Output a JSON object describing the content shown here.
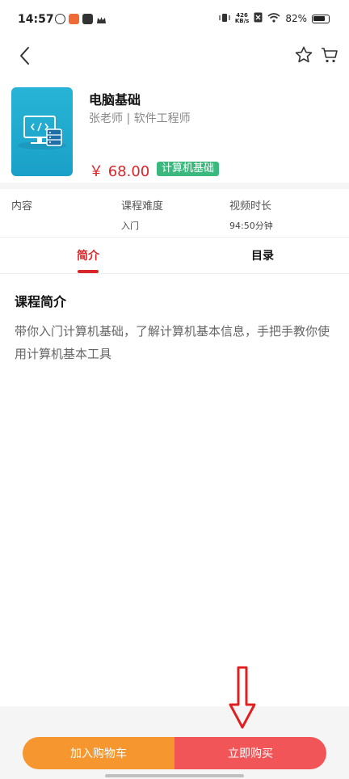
{
  "status_bar": {
    "time": "14:57",
    "net_speed_value": "426",
    "net_speed_unit": "KB/s",
    "battery": "82%"
  },
  "course": {
    "title": "电脑基础",
    "teacher": "张老师 | 软件工程师",
    "price": "￥ 68.00",
    "tag": "计算机基础"
  },
  "info": {
    "content_label": "内容",
    "difficulty_label": "课程难度",
    "difficulty_value": "入门",
    "duration_label": "视频时长",
    "duration_value": "94:50分钟"
  },
  "tabs": {
    "intro": "简介",
    "catalog": "目录"
  },
  "intro": {
    "title": "课程简介",
    "text": "带你入门计算机基础，了解计算机基本信息，手把手教你使用计算机基本工具"
  },
  "actions": {
    "add_to_cart": "加入购物车",
    "buy_now": "立即购买"
  },
  "colors": {
    "accent_red": "#d9262a",
    "tag_green": "#3bb87e",
    "cart_orange": "#f5962f",
    "buy_red": "#f25557"
  },
  "icons": {
    "back": "chevron-left-icon",
    "favorite": "star-outline-icon",
    "cart": "shopping-cart-icon"
  }
}
